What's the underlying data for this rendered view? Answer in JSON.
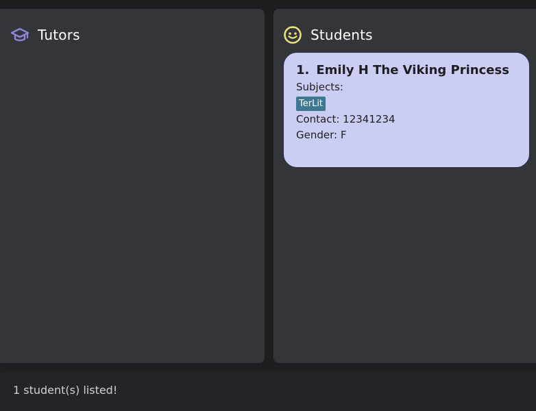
{
  "tutors_panel": {
    "title": "Tutors",
    "icon": "graduation-cap-icon"
  },
  "students_panel": {
    "title": "Students",
    "icon": "smiley-face-icon",
    "students": [
      {
        "index": "1.",
        "name": "Emily H The Viking Princess",
        "subjects_label": "Subjects:",
        "subjects": [
          "TerLit"
        ],
        "contact": "Contact: 12341234",
        "gender": "Gender: F"
      }
    ]
  },
  "status_bar": {
    "message": "1 student(s) listed!"
  },
  "colors": {
    "background": "#1d1e20",
    "panel": "#343539",
    "card": "#cbcdf2",
    "tag": "#3d7890",
    "tutor_icon": "#8e86d8",
    "student_icon": "#e9e27e"
  }
}
